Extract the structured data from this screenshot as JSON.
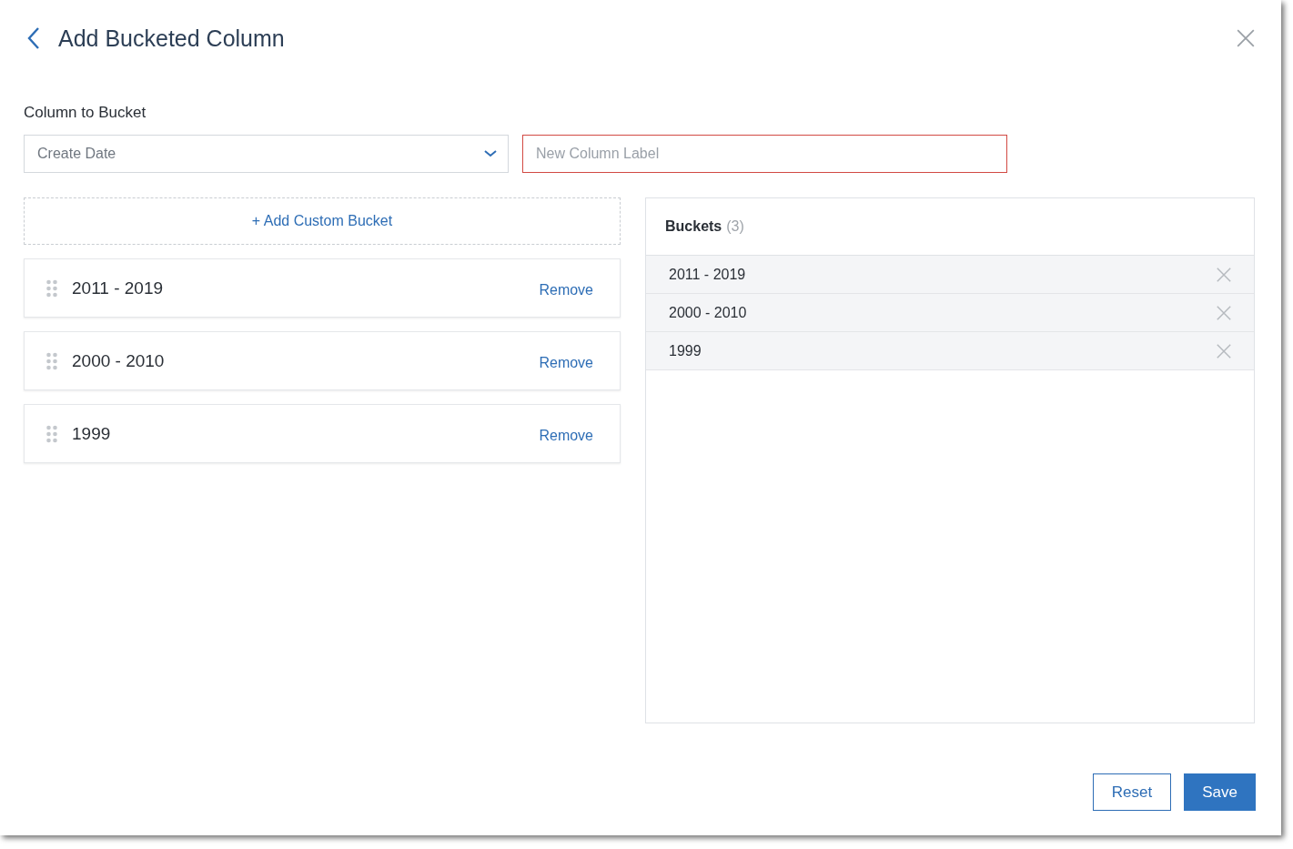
{
  "dialog": {
    "title": "Add Bucketed Column"
  },
  "column_to_bucket": {
    "label": "Column to Bucket",
    "value": "Create Date"
  },
  "new_label_field": {
    "placeholder": "New Column Label",
    "error": true
  },
  "add_custom_bucket": "+ Add Custom Bucket",
  "bucket_cards": [
    {
      "label": "2011 - 2019",
      "action": "Remove"
    },
    {
      "label": "2000 - 2010",
      "action": "Remove"
    },
    {
      "label": "1999",
      "action": "Remove"
    }
  ],
  "buckets_panel": {
    "title": "Buckets",
    "count": "(3)",
    "items": [
      {
        "label": "2011 - 2019"
      },
      {
        "label": "2000 - 2010"
      },
      {
        "label": "1999"
      }
    ]
  },
  "buttons": [
    {
      "label": "Reset",
      "kind": "secondary"
    },
    {
      "label": "Save",
      "kind": "primary"
    }
  ]
}
